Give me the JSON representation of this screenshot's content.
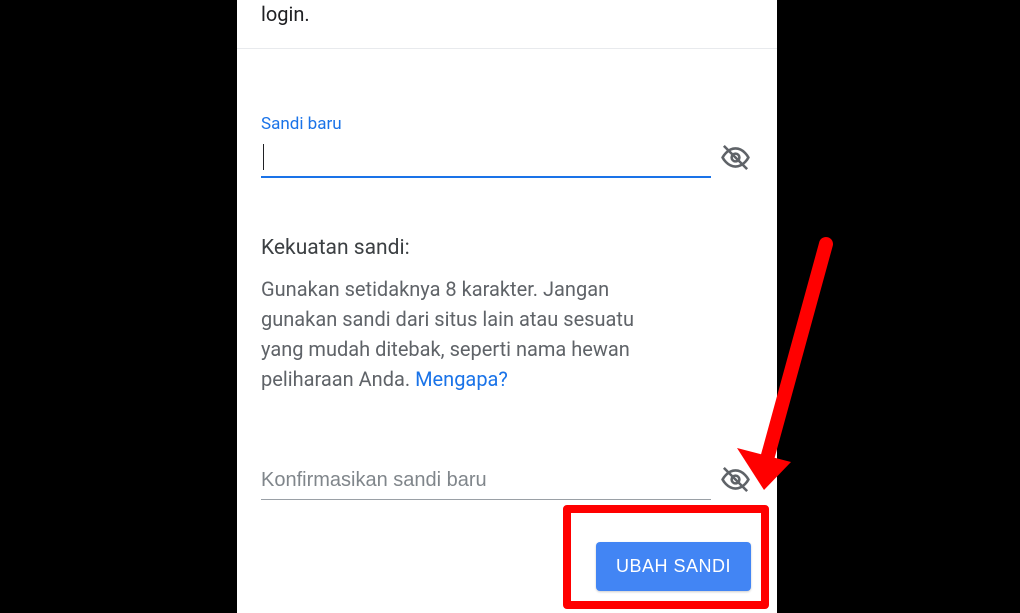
{
  "top_line_text": "login.",
  "new_password": {
    "label": "Sandi baru"
  },
  "strength": {
    "title": "Kekuatan sandi:",
    "description": "Gunakan setidaknya 8 karakter. Jangan gunakan sandi dari situs lain atau sesuatu yang mudah ditebak, seperti nama hewan peliharaan Anda. ",
    "why_link": "Mengapa?"
  },
  "confirm": {
    "placeholder": "Konfirmasikan sandi baru"
  },
  "submit_label": "UBAH SANDI"
}
